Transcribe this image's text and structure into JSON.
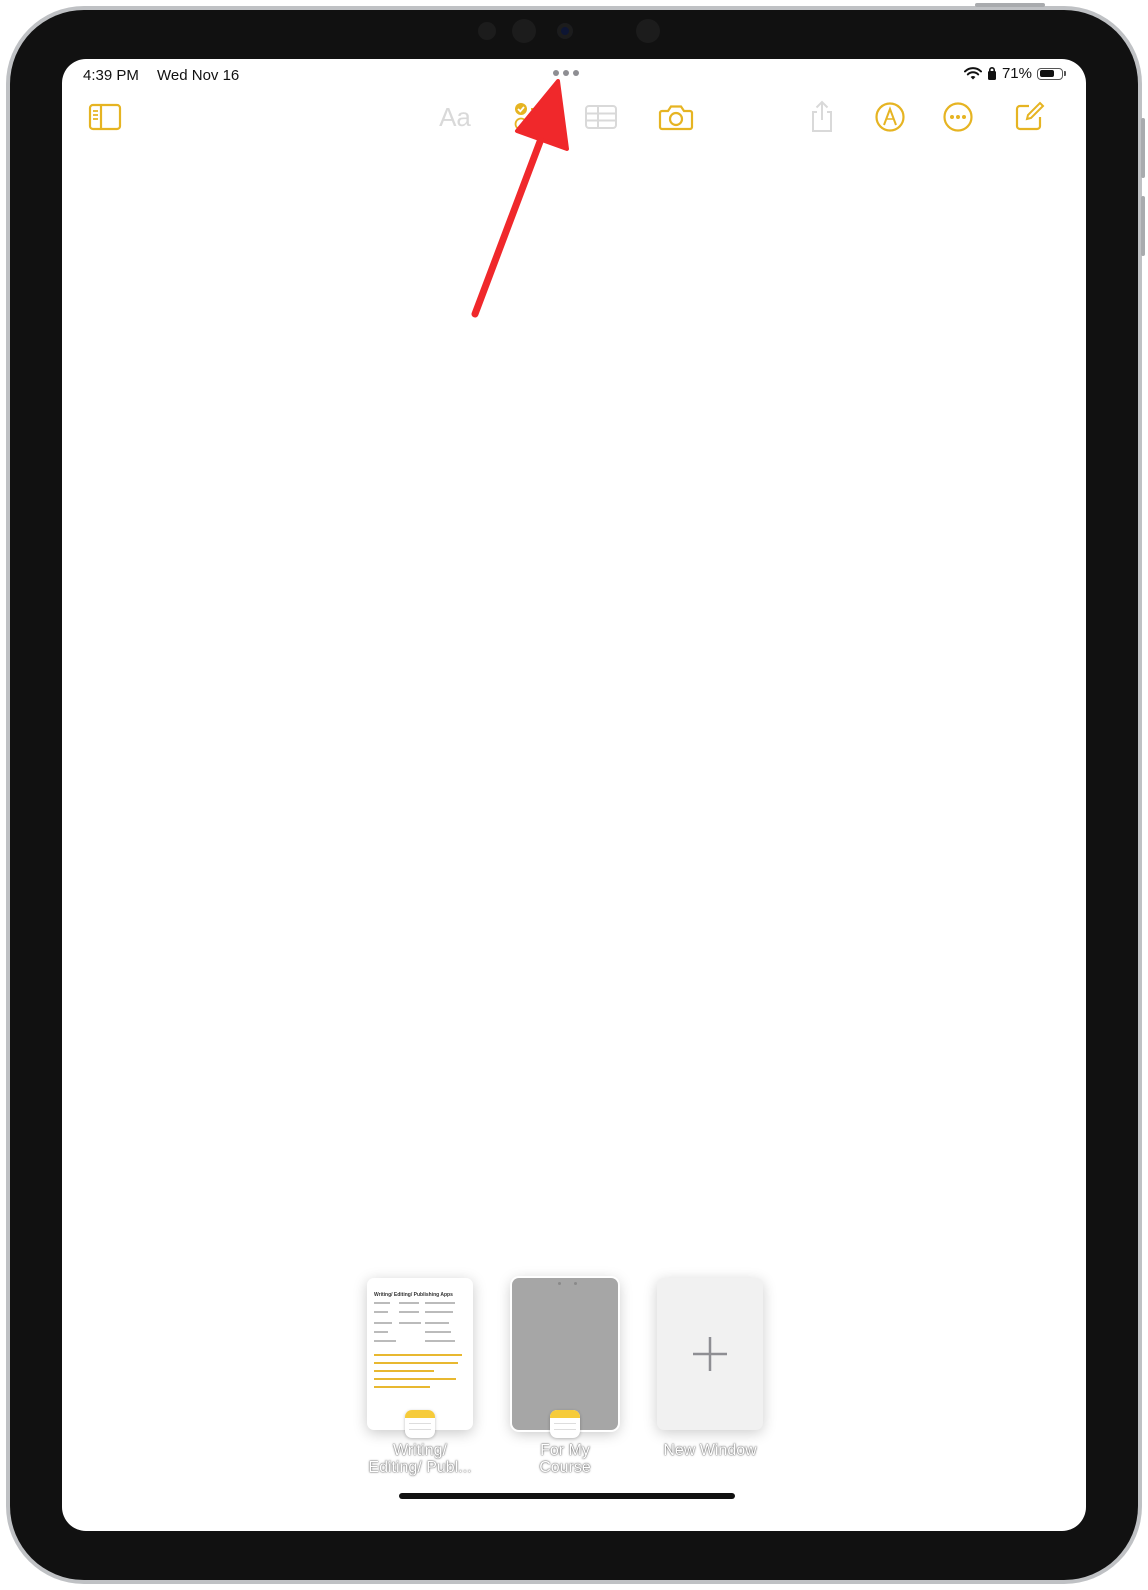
{
  "status_bar": {
    "time": "4:39 PM",
    "date": "Wed Nov 16",
    "battery_percent": "71%",
    "battery_level": 0.71
  },
  "toolbar": {
    "format_label": "Aa",
    "icons": [
      "sidebar-icon",
      "checklist-icon",
      "table-icon",
      "camera-icon",
      "share-icon",
      "markup-icon",
      "more-icon",
      "compose-icon"
    ],
    "accent_color": "#e6b422",
    "disabled_color": "#d9d9d9"
  },
  "annotation": {
    "arrow_color": "#f0282b"
  },
  "app_switcher": {
    "tiles": [
      {
        "caption": "Writing/\nEditing/ Publ...",
        "thumbnail_title": "Writing/ Editing/ Publishing Apps"
      },
      {
        "caption": "For My\nCourse"
      },
      {
        "caption": "New Window"
      }
    ]
  }
}
